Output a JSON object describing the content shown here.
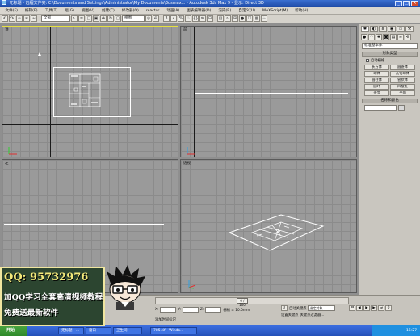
{
  "window": {
    "title": "无标题 - 远程文件夹: C:\\Documents and Settings\\Administrator\\My Documents\\3dsmax... - Autodesk 3ds Max 9 - 显示: Direct 3D",
    "controls": [
      "_",
      "□",
      "×"
    ]
  },
  "menu": [
    "文件(F)",
    "编辑(E)",
    "工具(T)",
    "组(G)",
    "视图(V)",
    "创建(C)",
    "修改器(O)",
    "reactor",
    "动画(A)",
    "图表编辑器(D)",
    "渲染(R)",
    "自定义(U)",
    "MAXScript(M)",
    "帮助(H)"
  ],
  "toolbar": {
    "selection_filter": "全部",
    "view_coord": "视图"
  },
  "viewports": [
    {
      "id": "top",
      "label": "顶",
      "active": true
    },
    {
      "id": "front",
      "label": "前",
      "active": false
    },
    {
      "id": "left",
      "label": "左",
      "active": false
    },
    {
      "id": "perspective",
      "label": "透视",
      "active": false
    }
  ],
  "command_panel": {
    "category_dropdown": "标准基本体",
    "rollout_object_type": "对象类型",
    "auto_grid": "自动栅格",
    "buttons": [
      "长方体",
      "圆锥体",
      "球体",
      "几何球体",
      "圆柱体",
      "管状体",
      "圆环",
      "四棱锥",
      "茶壶",
      "平面"
    ],
    "rollout_name_color": "名称和颜色"
  },
  "status": {
    "time_slider": "0 / 100",
    "coord_x": "X:",
    "coord_y": "Y:",
    "coord_z": "Z:",
    "grid_text": "栅格 = 10.0mm",
    "auto_key": "自动关键点",
    "set_key": "设置关键点",
    "key_filter_selected": "选定对象",
    "key_filters": "关键点过滤器...",
    "add_time_tag": "添加时间标记",
    "frame": "0"
  },
  "taskbar": {
    "start": "开始",
    "items": [
      "无标题 - ...",
      "窗口",
      "卫生间",
      "785.tif - Windo..."
    ],
    "clock": "16:27"
  },
  "overlay_ad": {
    "line1": "QQ: 95732976",
    "line2": "加QQ学习全套高清视频教程",
    "line3": "免费送最新软件"
  },
  "colors": {
    "viewport_bg": "#9a9a9a",
    "active_border": "#e6e040",
    "ad_bg": "#2c4530",
    "ad_qq": "#f3e97a"
  }
}
